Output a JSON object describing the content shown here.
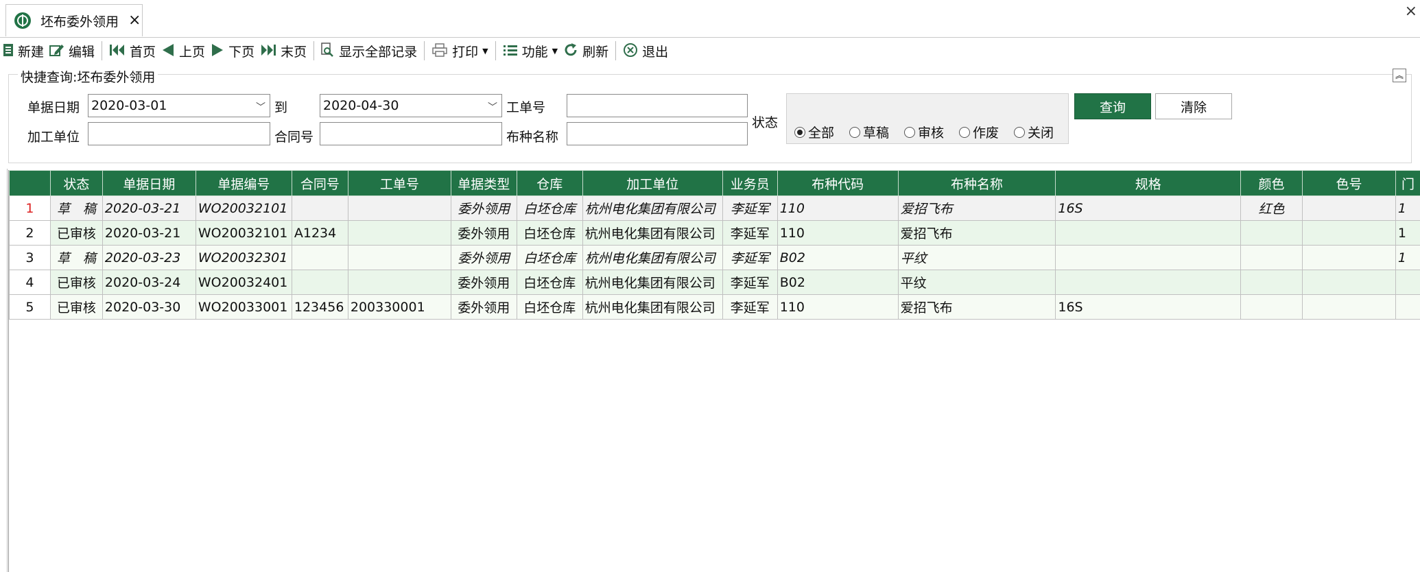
{
  "tab": {
    "title": "坯布委外领用",
    "close": "×"
  },
  "window": {
    "close": "×"
  },
  "toolbar": {
    "new": "新建",
    "edit": "编辑",
    "first": "首页",
    "prev": "上页",
    "next": "下页",
    "last": "末页",
    "show_all": "显示全部记录",
    "print": "打印",
    "functions": "功能",
    "refresh": "刷新",
    "exit": "退出"
  },
  "icons": {
    "new": "document-icon",
    "edit": "edit-icon",
    "first": "first-page-icon",
    "prev": "prev-page-icon",
    "next": "next-page-icon",
    "last": "last-page-icon",
    "show_all": "search-icon",
    "print": "printer-icon",
    "functions": "list-icon",
    "refresh": "refresh-icon",
    "exit": "close-circle-icon"
  },
  "filter": {
    "title": "快捷查询:坯布委外领用",
    "date_label": "单据日期",
    "date_from": "2020-03-01",
    "to_label": "到",
    "date_to": "2020-04-30",
    "job_no_label": "工单号",
    "job_no": "",
    "unit_label": "加工单位",
    "unit": "",
    "contract_label": "合同号",
    "contract": "",
    "fabric_label": "布种名称",
    "fabric": "",
    "status_label": "状态",
    "status_options": [
      "全部",
      "草稿",
      "审核",
      "作废",
      "关闭"
    ],
    "status_selected": "全部",
    "query": "查询",
    "clear": "清除"
  },
  "grid": {
    "columns": [
      "",
      "状态",
      "单据日期",
      "单据编号",
      "合同号",
      "工单号",
      "单据类型",
      "仓库",
      "加工单位",
      "业务员",
      "布种代码",
      "布种名称",
      "规格",
      "颜色",
      "色号",
      "门"
    ],
    "rows": [
      {
        "n": "1",
        "status": "草　稿",
        "date": "2020-03-21",
        "doc_no": "WO20032101",
        "contract": "",
        "job": "",
        "type": "委外领用",
        "warehouse": "白坯仓库",
        "unit": "杭州电化集团有限公司",
        "staff": "李延军",
        "fabric_code": "110",
        "fabric_name": "爱招飞布",
        "spec": "16S",
        "color": "红色",
        "color_no": "",
        "extra": "1"
      },
      {
        "n": "2",
        "status": "已审核",
        "date": "2020-03-21",
        "doc_no": "WO20032101",
        "contract": "A1234",
        "job": "",
        "type": "委外领用",
        "warehouse": "白坯仓库",
        "unit": "杭州电化集团有限公司",
        "staff": "李延军",
        "fabric_code": "110",
        "fabric_name": "爱招飞布",
        "spec": "",
        "color": "",
        "color_no": "",
        "extra": "1"
      },
      {
        "n": "3",
        "status": "草　稿",
        "date": "2020-03-23",
        "doc_no": "WO20032301",
        "contract": "",
        "job": "",
        "type": "委外领用",
        "warehouse": "白坯仓库",
        "unit": "杭州电化集团有限公司",
        "staff": "李延军",
        "fabric_code": "B02",
        "fabric_name": "平纹",
        "spec": "",
        "color": "",
        "color_no": "",
        "extra": "1"
      },
      {
        "n": "4",
        "status": "已审核",
        "date": "2020-03-24",
        "doc_no": "WO20032401",
        "contract": "",
        "job": "",
        "type": "委外领用",
        "warehouse": "白坯仓库",
        "unit": "杭州电化集团有限公司",
        "staff": "李延军",
        "fabric_code": "B02",
        "fabric_name": "平纹",
        "spec": "",
        "color": "",
        "color_no": "",
        "extra": ""
      },
      {
        "n": "5",
        "status": "已审核",
        "date": "2020-03-30",
        "doc_no": "WO20033001",
        "contract": "123456",
        "job": "200330001",
        "type": "委外领用",
        "warehouse": "白坯仓库",
        "unit": "杭州电化集团有限公司",
        "staff": "李延军",
        "fabric_code": "110",
        "fabric_name": "爱招飞布",
        "spec": "16S",
        "color": "",
        "color_no": "",
        "extra": ""
      }
    ]
  }
}
